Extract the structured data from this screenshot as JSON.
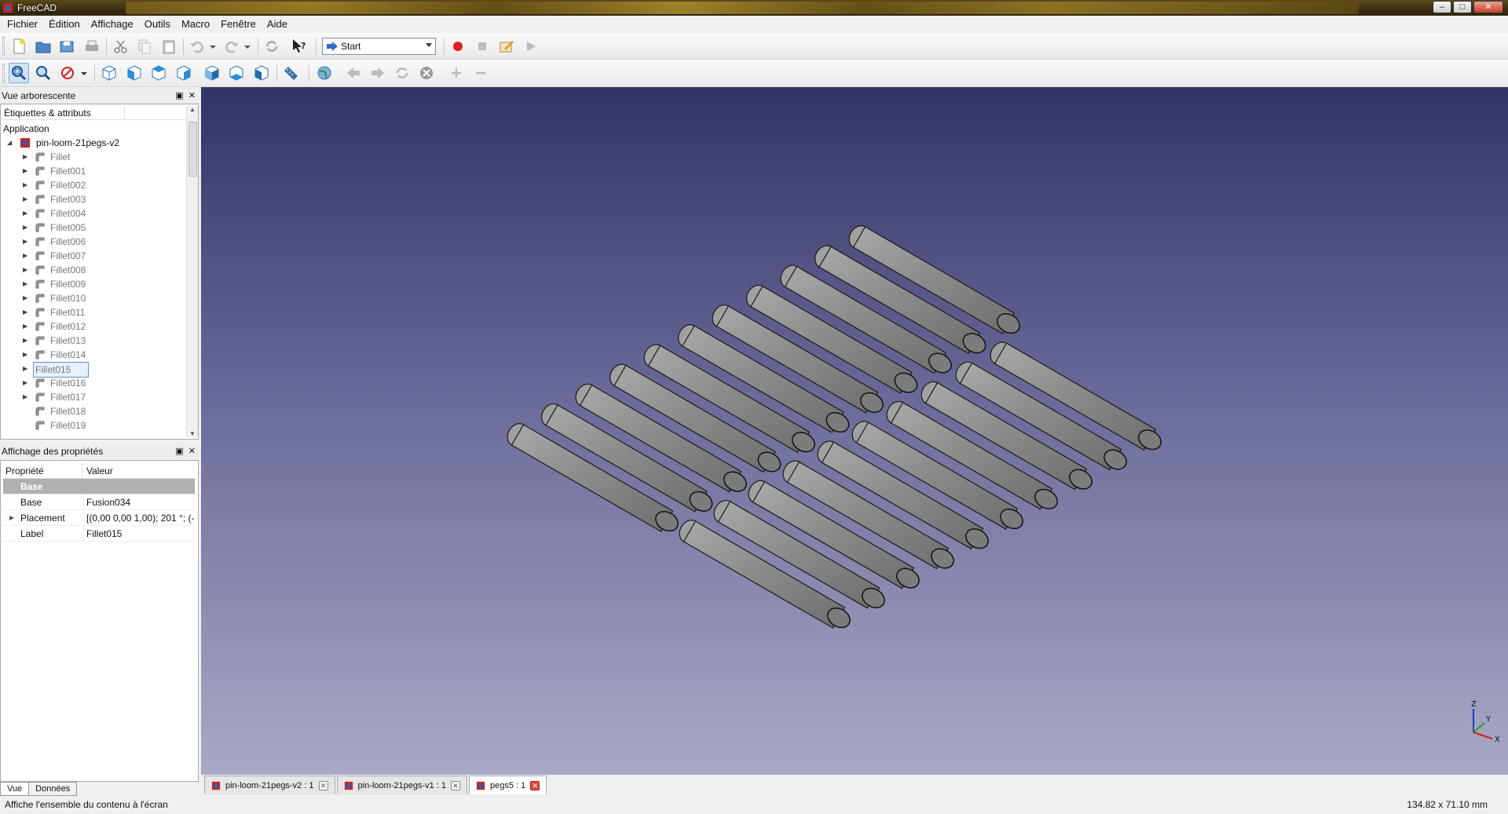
{
  "window": {
    "title": "FreeCAD",
    "minimize": "–",
    "maximize": "□",
    "close": "✕"
  },
  "menu": [
    "Fichier",
    "Édition",
    "Affichage",
    "Outils",
    "Macro",
    "Fenêtre",
    "Aide"
  ],
  "toolbar": {
    "workbench": "Start"
  },
  "tree_panel": {
    "title": "Vue arborescente",
    "column_labels": "Étiquettes & attributs",
    "root": "Application",
    "document": "pin-loom-21pegs-v2",
    "items": [
      "Fillet",
      "Fillet001",
      "Fillet002",
      "Fillet003",
      "Fillet004",
      "Fillet005",
      "Fillet006",
      "Fillet007",
      "Fillet008",
      "Fillet009",
      "Fillet010",
      "Fillet011",
      "Fillet012",
      "Fillet013",
      "Fillet014",
      "Fillet015",
      "Fillet016",
      "Fillet017",
      "Fillet018",
      "Fillet019"
    ],
    "selected": "Fillet015"
  },
  "property_panel": {
    "title": "Affichage des propriétés",
    "col_property": "Propriété",
    "col_value": "Valeur",
    "group": "Base",
    "rows": [
      {
        "key": "Base",
        "value": "Fusion034"
      },
      {
        "key": "Placement",
        "value": "[(0,00 0,00 1,00); 201 °; (-..."
      },
      {
        "key": "Label",
        "value": "Fillet015"
      }
    ],
    "tabs": [
      "Vue",
      "Données"
    ]
  },
  "doc_tabs": [
    {
      "label": "pin-loom-21pegs-v2 : 1",
      "active": false
    },
    {
      "label": "pin-loom-21pegs-v1 : 1",
      "active": false
    },
    {
      "label": "pegs5 : 1",
      "active": true
    }
  ],
  "axis": {
    "z": "Z",
    "y": "Y",
    "x": "X"
  },
  "status": {
    "message": "Affiche l'ensemble du contenu à l'écran",
    "dimensions": "134.82 x 71.10 mm"
  },
  "colors": {
    "selection_border": "#5b8fd1",
    "viewport_top": "#333366",
    "viewport_bottom": "#a9a9c6",
    "peg_fill": "#8a8a8a"
  }
}
